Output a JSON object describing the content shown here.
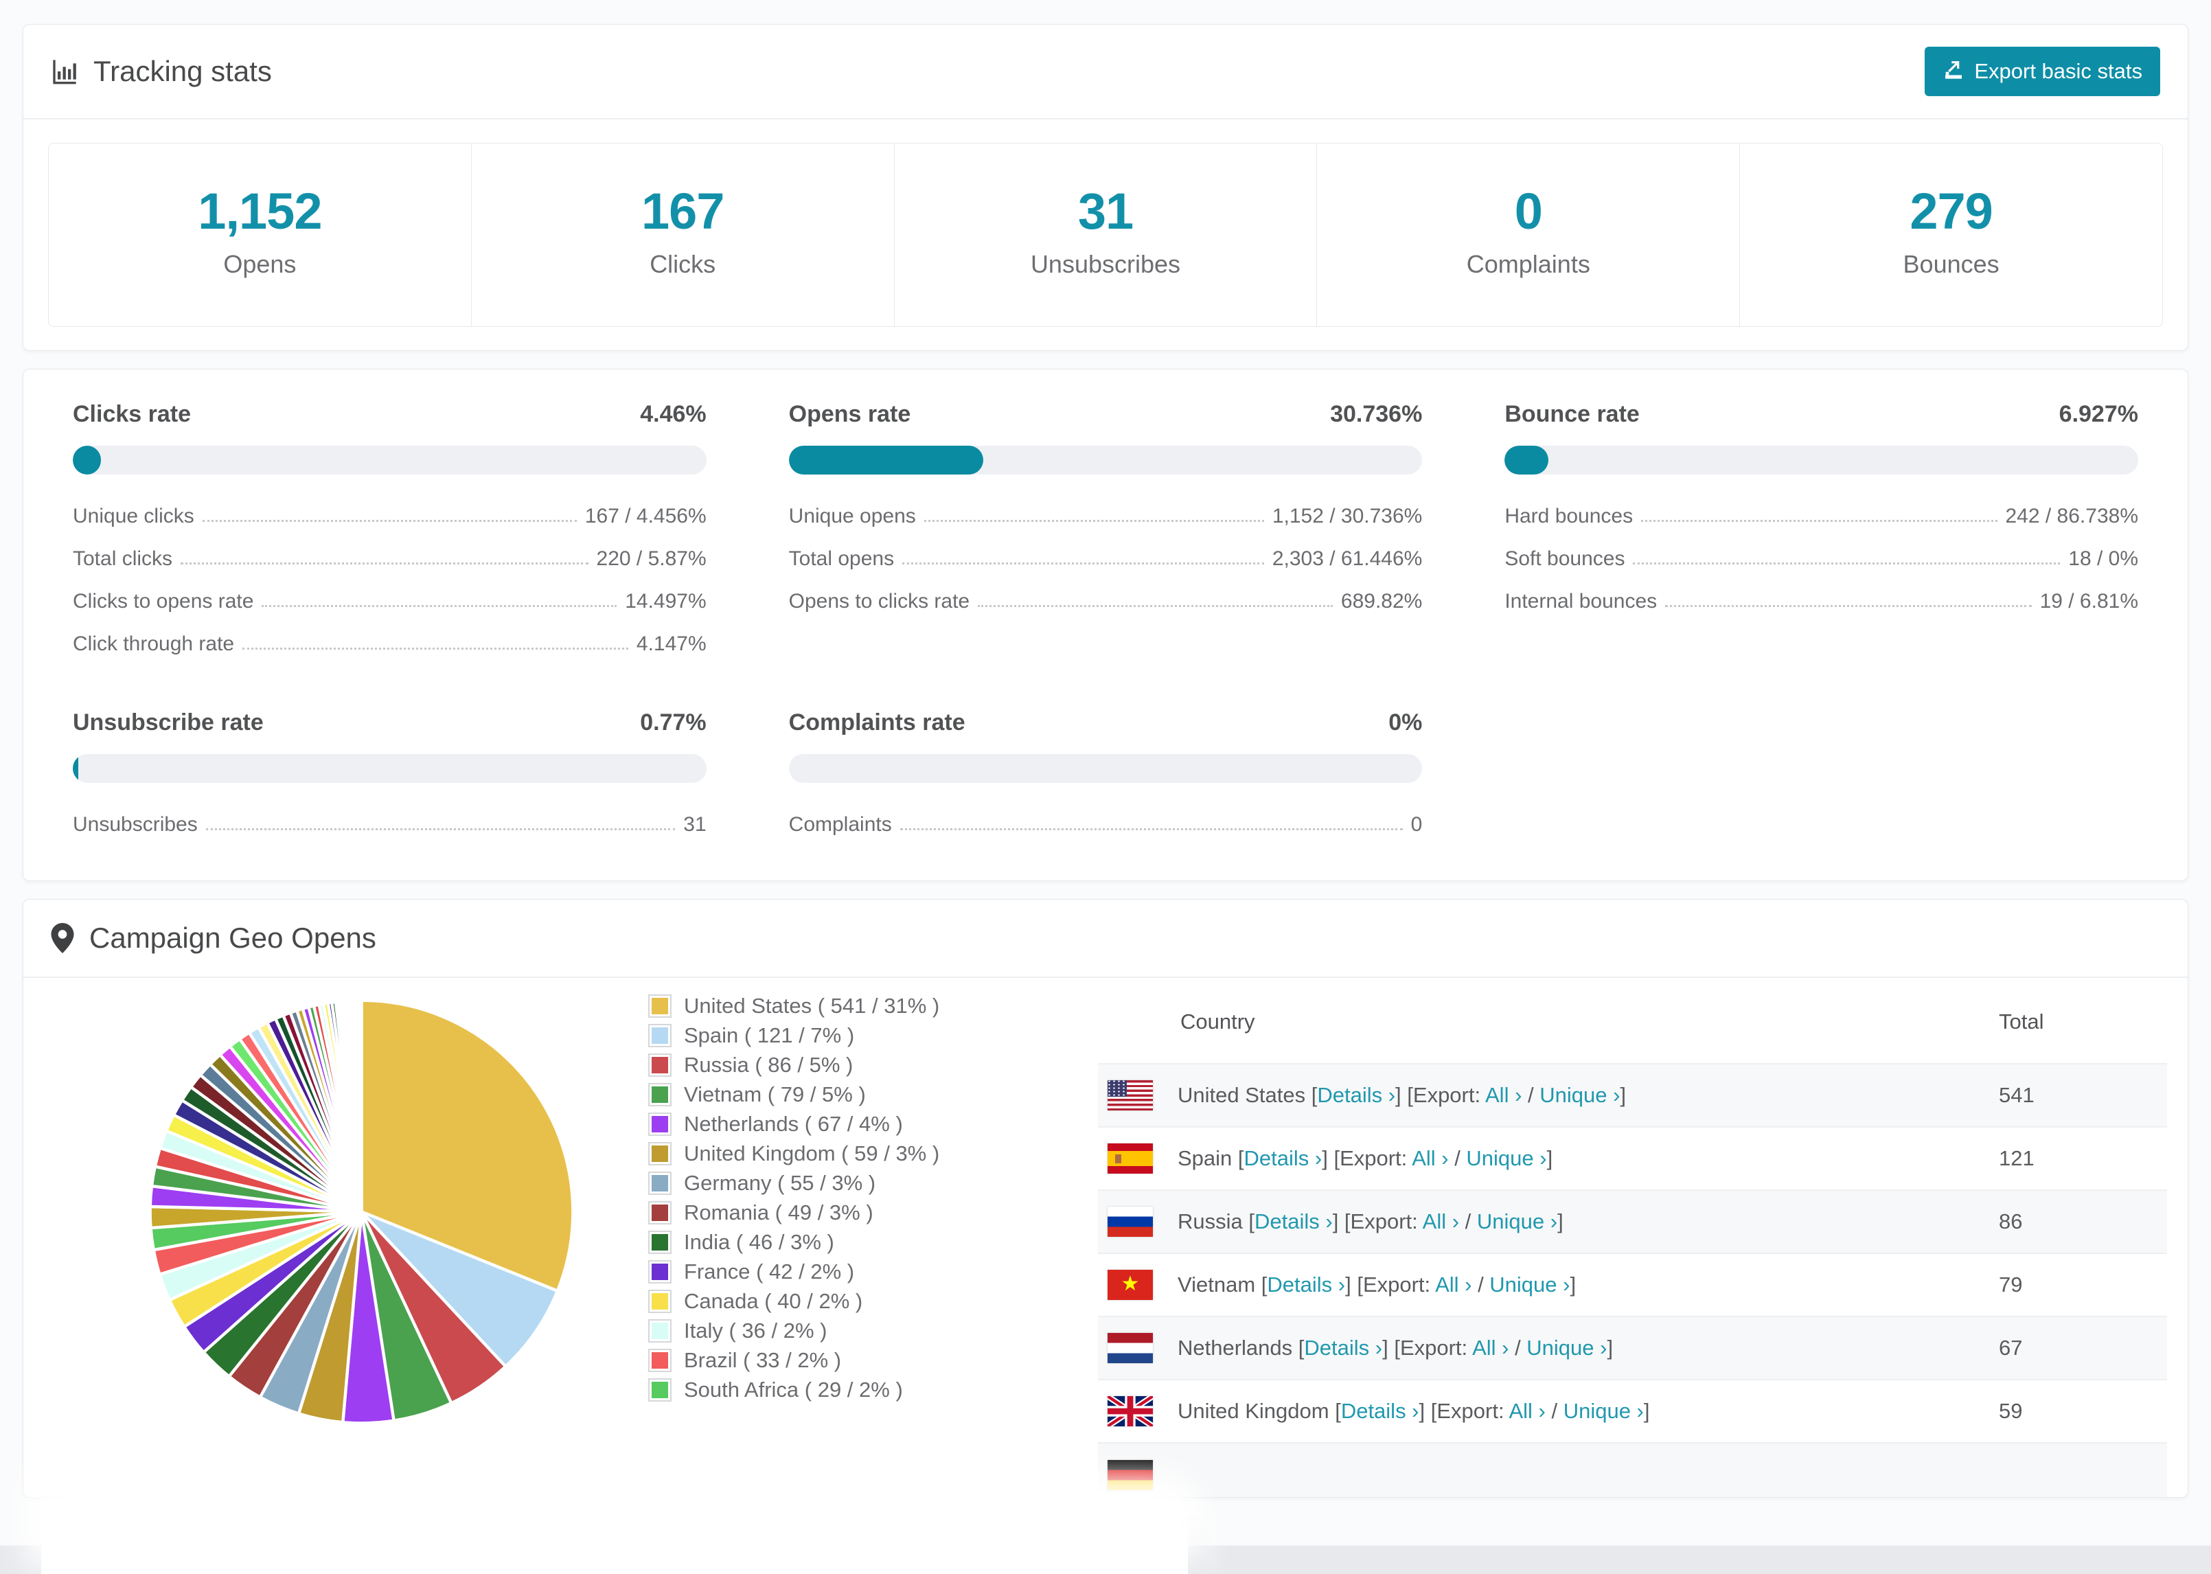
{
  "tracking": {
    "title": "Tracking stats",
    "export_button": "Export basic stats",
    "stats": [
      {
        "value": "1,152",
        "label": "Opens"
      },
      {
        "value": "167",
        "label": "Clicks"
      },
      {
        "value": "31",
        "label": "Unsubscribes"
      },
      {
        "value": "0",
        "label": "Complaints"
      },
      {
        "value": "279",
        "label": "Bounces"
      }
    ]
  },
  "rates": [
    {
      "title": "Clicks rate",
      "percent": "4.46%",
      "fill_pct": 4.46,
      "rows": [
        [
          "Unique clicks",
          "167 / 4.456%"
        ],
        [
          "Total clicks",
          "220 / 5.87%"
        ],
        [
          "Clicks to opens rate",
          "14.497%"
        ],
        [
          "Click through rate",
          "4.147%"
        ]
      ]
    },
    {
      "title": "Opens rate",
      "percent": "30.736%",
      "fill_pct": 30.736,
      "rows": [
        [
          "Unique opens",
          "1,152 / 30.736%"
        ],
        [
          "Total opens",
          "2,303 / 61.446%"
        ],
        [
          "Opens to clicks rate",
          "689.82%"
        ]
      ]
    },
    {
      "title": "Bounce rate",
      "percent": "6.927%",
      "fill_pct": 6.927,
      "rows": [
        [
          "Hard bounces",
          "242 / 86.738%"
        ],
        [
          "Soft bounces",
          "18 / 0%"
        ],
        [
          "Internal bounces",
          "19 / 6.81%"
        ]
      ]
    },
    {
      "title": "Unsubscribe rate",
      "percent": "0.77%",
      "fill_pct": 0.77,
      "rows": [
        [
          "Unsubscribes",
          "31"
        ]
      ]
    },
    {
      "title": "Complaints rate",
      "percent": "0%",
      "fill_pct": 0,
      "rows": [
        [
          "Complaints",
          "0"
        ]
      ]
    }
  ],
  "geo": {
    "title": "Campaign Geo Opens",
    "table": {
      "columns": [
        "Country",
        "Total"
      ],
      "link_labels": {
        "details": "Details ›",
        "export": "Export:",
        "all": "All ›",
        "slash": "/",
        "unique": "Unique ›"
      },
      "rows": [
        {
          "flag": "us",
          "country": "United States",
          "total": "541"
        },
        {
          "flag": "es",
          "country": "Spain",
          "total": "121"
        },
        {
          "flag": "ru",
          "country": "Russia",
          "total": "86"
        },
        {
          "flag": "vn",
          "country": "Vietnam",
          "total": "79"
        },
        {
          "flag": "nl",
          "country": "Netherlands",
          "total": "67"
        },
        {
          "flag": "gb",
          "country": "United Kingdom",
          "total": "59"
        }
      ],
      "partial_row": {
        "flag": "de"
      }
    }
  },
  "chart_data": {
    "type": "pie",
    "title": "Campaign Geo Opens",
    "legend_position": "right",
    "slices": [
      {
        "label": "United States",
        "value": 541,
        "pct": "31%",
        "color": "#e7c04b"
      },
      {
        "label": "Spain",
        "value": 121,
        "pct": "7%",
        "color": "#b5d9f2"
      },
      {
        "label": "Russia",
        "value": 86,
        "pct": "5%",
        "color": "#ca4a4e"
      },
      {
        "label": "Vietnam",
        "value": 79,
        "pct": "5%",
        "color": "#4aa24f"
      },
      {
        "label": "Netherlands",
        "value": 67,
        "pct": "4%",
        "color": "#9d3ef2"
      },
      {
        "label": "United Kingdom",
        "value": 59,
        "pct": "3%",
        "color": "#bf9b30"
      },
      {
        "label": "Germany",
        "value": 55,
        "pct": "3%",
        "color": "#8aabc4"
      },
      {
        "label": "Romania",
        "value": 49,
        "pct": "3%",
        "color": "#a33f3c"
      },
      {
        "label": "India",
        "value": 46,
        "pct": "3%",
        "color": "#29742f"
      },
      {
        "label": "France",
        "value": 42,
        "pct": "2%",
        "color": "#6c2fd1"
      },
      {
        "label": "Canada",
        "value": 40,
        "pct": "2%",
        "color": "#f8e04a"
      },
      {
        "label": "Italy",
        "value": 36,
        "pct": "2%",
        "color": "#d8fdf6"
      },
      {
        "label": "Brazil",
        "value": 33,
        "pct": "2%",
        "color": "#f25c5c"
      },
      {
        "label": "South Africa",
        "value": 29,
        "pct": "2%",
        "color": "#55cb60"
      }
    ],
    "other_small_slices": {
      "values": [
        28,
        27,
        26,
        25,
        24,
        23,
        22,
        21,
        20,
        19,
        18,
        17,
        16,
        15,
        14,
        13,
        12,
        11,
        10,
        9,
        8,
        8,
        7,
        7,
        6,
        6,
        5,
        5,
        4,
        4,
        3,
        3,
        3,
        2,
        2,
        2,
        2,
        1,
        1,
        1,
        1,
        1,
        1,
        1,
        1,
        1
      ],
      "palette": [
        "#c7a62b",
        "#9d3ef2",
        "#4aa24f",
        "#e24c4c",
        "#d8fdf6",
        "#f7ef4a",
        "#372f8f",
        "#1d5c2a",
        "#7a2329",
        "#5b7d99",
        "#8a7a1e",
        "#d946ef",
        "#6ee76e",
        "#fb6b6b",
        "#bfe3f7",
        "#fef08a",
        "#4c1d95",
        "#14532d",
        "#881337",
        "#6b7f93"
      ]
    }
  },
  "colors": {
    "accent": "#1390a9",
    "link": "#2098ae",
    "bar_fill": "#0a8ba1"
  }
}
